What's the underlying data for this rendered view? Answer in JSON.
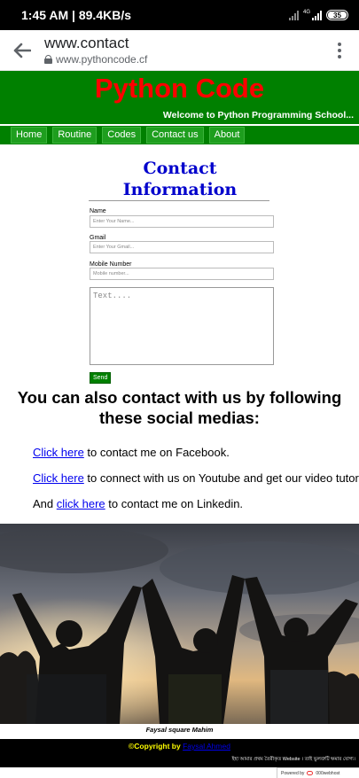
{
  "status_bar": {
    "left_text": "1:45 AM | 89.4KB/s",
    "network_label": "4G",
    "battery_level": "35"
  },
  "browser": {
    "page_title": "www.contact",
    "url": "www.pythoncode.cf"
  },
  "site": {
    "title": "Python Code",
    "welcome": "Welcome to Python Programming School...",
    "nav": [
      "Home",
      "Routine",
      "Codes",
      "Contact us",
      "About"
    ]
  },
  "contact_form": {
    "heading_line1": "Contact",
    "heading_line2": "Information",
    "name_label": "Name",
    "name_placeholder": "Enter Your Name...",
    "gmail_label": "Gmail",
    "gmail_placeholder": "Enter Your Gmail...",
    "mobile_label": "Mobile Number",
    "mobile_placeholder": "Mobile number...",
    "message_placeholder": "Text....",
    "send_label": "Send"
  },
  "social": {
    "heading": "You can also contact with us by following these social medias:",
    "facebook": {
      "prefix": "",
      "link": "Click here",
      "suffix": " to contact me on Facebook."
    },
    "youtube": {
      "prefix": "",
      "link": "Click here",
      "suffix": " to connect with us on Youtube and get our video tutorial."
    },
    "linkedin": {
      "prefix": "And ",
      "link": "click here",
      "suffix": " to contact me on Linkedin."
    }
  },
  "photo": {
    "caption": "Faysal square Mahim"
  },
  "footer": {
    "copyright_prefix": "©Copyright by ",
    "author": "Faysal Ahmed",
    "note": "ইহা আমার প্রথম তৈরীকৃত Website । তাই ভুলত্রুটি ক্ষমার যোগ্য।",
    "powered_by": "Powered by",
    "host_name": "000webhost"
  },
  "colors": {
    "site_green": "#008000",
    "title_red": "#ff0000",
    "heading_blue": "#0000cc",
    "link_blue": "#0000ee",
    "copyright_yellow": "#ffff00"
  }
}
